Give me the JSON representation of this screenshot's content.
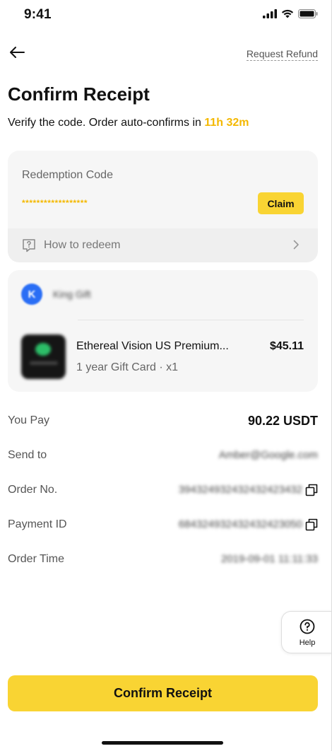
{
  "status_bar": {
    "time": "9:41"
  },
  "nav": {
    "request_refund": "Request Refund"
  },
  "header": {
    "title": "Confirm Receipt",
    "subtitle_prefix": "Verify the code. Order auto-confirms in ",
    "countdown": "11h 32m",
    "countdown_color": "#f4b800"
  },
  "redemption": {
    "label": "Redemption Code",
    "code_masked": "******************",
    "claim_label": "Claim",
    "how_to": "How to redeem"
  },
  "product": {
    "store_name": "King Gift",
    "store_logo_letter": "K",
    "name": "Ethereal Vision US Premium...",
    "price": "$45.11",
    "subtitle": "1 year Gift Card · x1"
  },
  "details": [
    {
      "label": "You Pay",
      "value": "90.22 USDT"
    },
    {
      "label": "Send to",
      "value": "Amber@Google.com"
    },
    {
      "label": "Order No.",
      "value": "394324932432432423432"
    },
    {
      "label": "Payment ID",
      "value": "684324932432432423050"
    },
    {
      "label": "Order Time",
      "value": "2019-09-01 11:11:33"
    }
  ],
  "help": {
    "label": "Help"
  },
  "footer": {
    "confirm_label": "Confirm Receipt"
  },
  "colors": {
    "accent": "#f9d433",
    "accent_text": "#f4b800",
    "card_bg": "#f6f6f6"
  }
}
